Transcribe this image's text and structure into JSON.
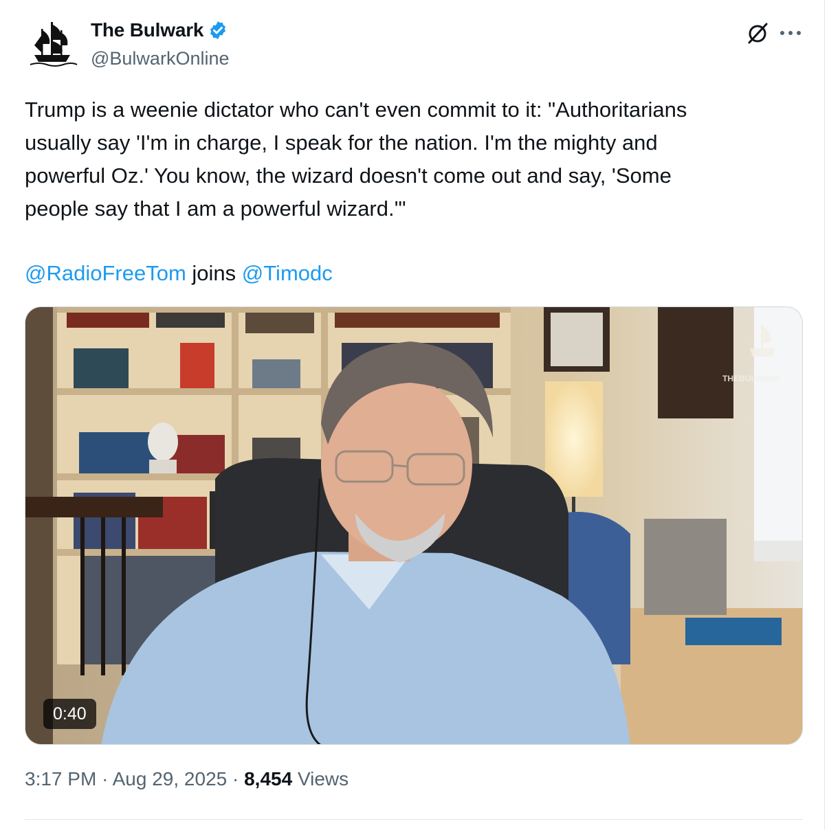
{
  "tweet": {
    "author": {
      "display_name": "The Bulwark",
      "handle": "@BulwarkOnline",
      "avatar_icon": "ship-logo-icon",
      "verified_icon": "verified-badge-icon",
      "verified_color": "#1d9bf0"
    },
    "text_lines": [
      "Trump is a weenie dictator who can't even commit to it: \"Authoritarians",
      "usually say 'I'm in charge, I speak for the nation. I'm the mighty and",
      "powerful Oz.' You know, the wizard doesn't come out and say, 'Some",
      "people say that I am a powerful wizard.'\""
    ],
    "mentions": {
      "first": "@RadioFreeTom",
      "joiner": "joins",
      "second": "@Timodc"
    },
    "media": {
      "duration": "0:40",
      "watermark": "THEBULWARK"
    },
    "meta": {
      "time": "3:17 PM",
      "separator": "·",
      "date": "Aug 29, 2025",
      "views_count": "8,454",
      "views_label": "Views"
    }
  },
  "colors": {
    "link": "#1d9bf0",
    "secondary_text": "#536471",
    "primary_text": "#0f1419"
  }
}
